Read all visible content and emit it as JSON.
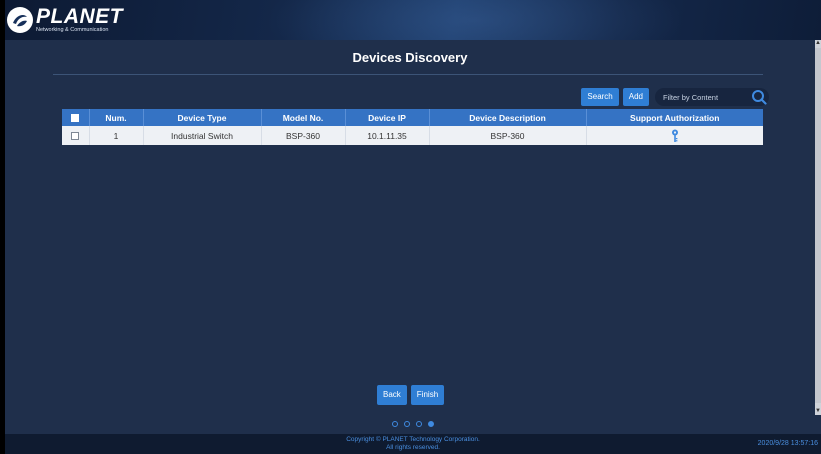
{
  "header": {
    "logo_word": "PLANET",
    "logo_tagline": "Networking & Communication"
  },
  "page": {
    "title": "Devices Discovery"
  },
  "toolbar": {
    "search_label": "Search",
    "add_label": "Add",
    "filter_placeholder": "Filter by Content"
  },
  "table": {
    "columns": [
      "Num.",
      "Device Type",
      "Model No.",
      "Device IP",
      "Device Description",
      "Support Authorization"
    ],
    "rows": [
      {
        "num": "1",
        "device_type": "Industrial Switch",
        "model_no": "BSP-360",
        "device_ip": "10.1.11.35",
        "device_description": "BSP-360",
        "support_authorization": "key-icon"
      }
    ]
  },
  "actions": {
    "back_label": "Back",
    "finish_label": "Finish"
  },
  "stepper": {
    "total_steps": 4,
    "current_step": 4
  },
  "footer": {
    "copyright_line1": "Copyright © PLANET Technology Corporation.",
    "copyright_line2": "All rights reserved.",
    "timestamp": "2020/9/28 13:57:16"
  },
  "colors": {
    "background": "#1f2f4b",
    "accent": "#2f7ed4",
    "table_header": "#3573c4",
    "footer_text": "#4a8fe0"
  }
}
